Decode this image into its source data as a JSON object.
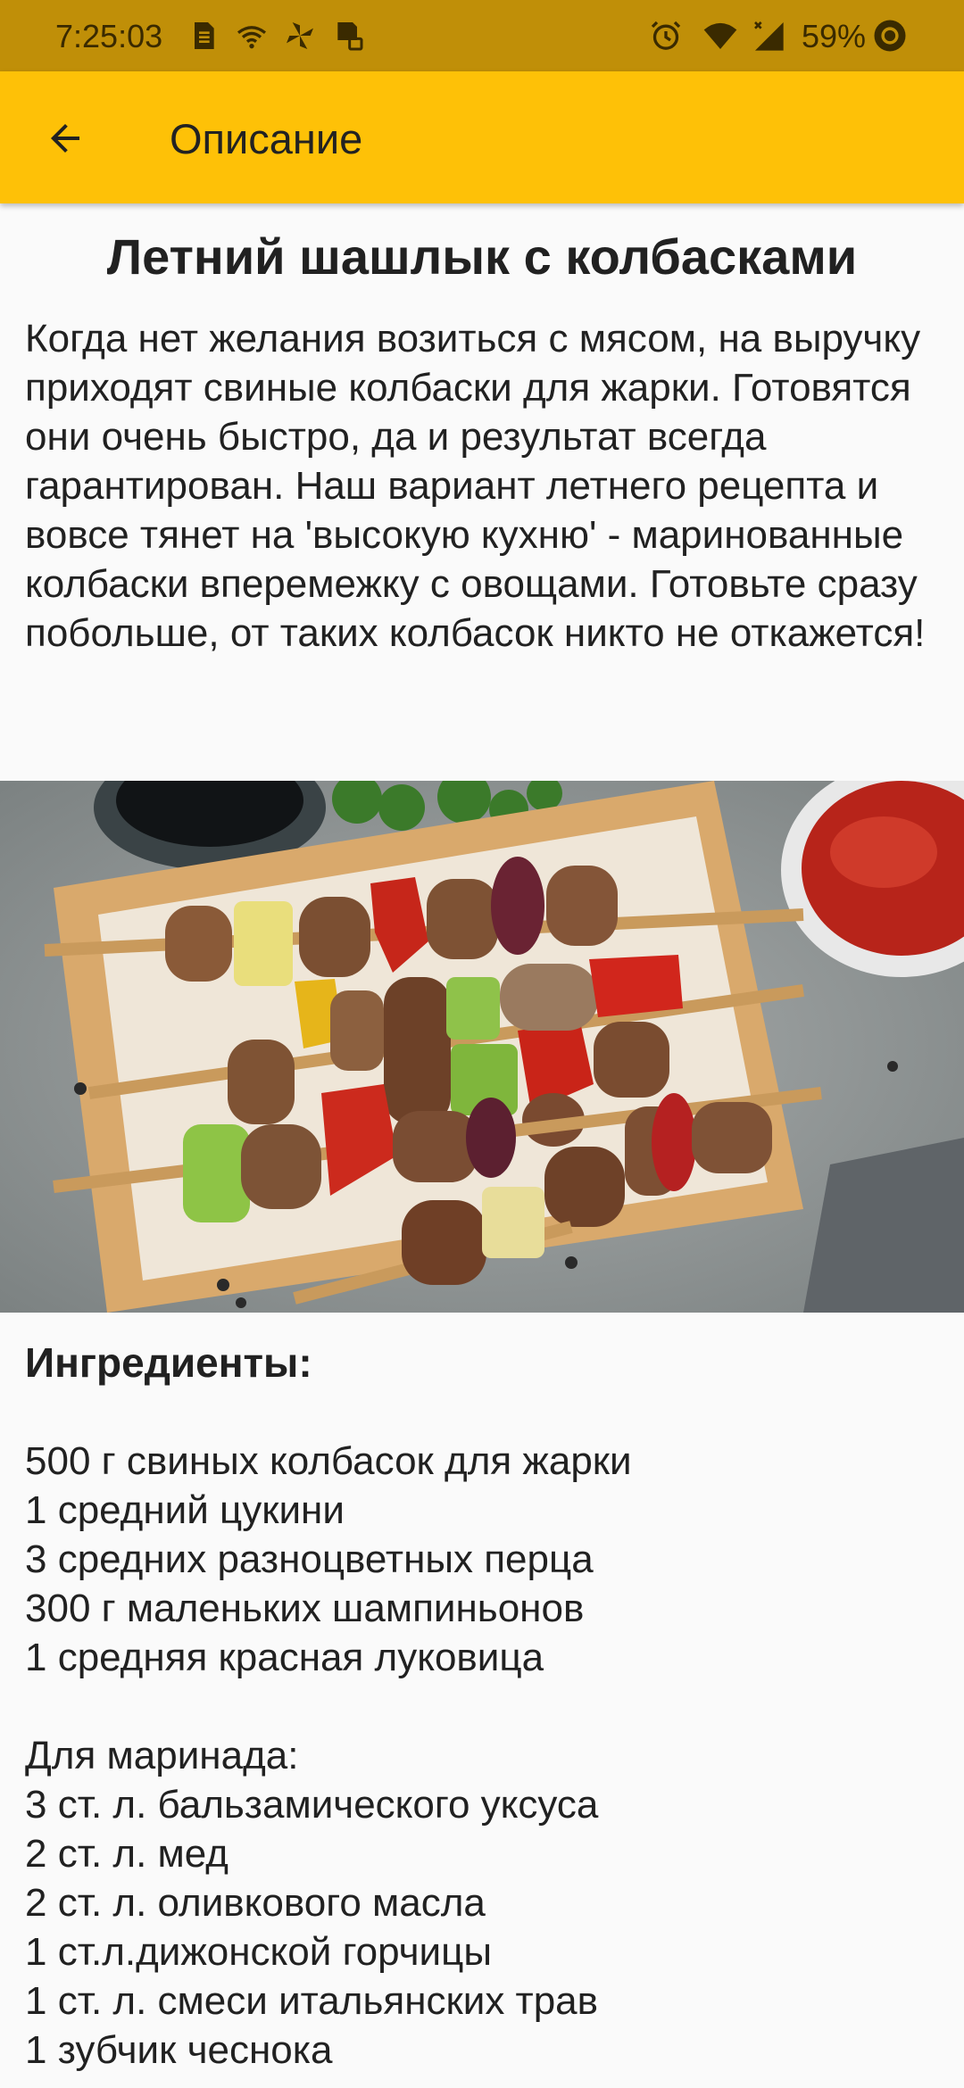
{
  "status_bar": {
    "time": "7:25:03",
    "battery_percent": "59%",
    "icons_left": [
      "sim-card-icon",
      "wifi-call-icon",
      "pinwheel-icon",
      "sd-card-icon"
    ],
    "icons_right": [
      "alarm-icon",
      "wifi-icon",
      "signal-icon",
      "battery-icon"
    ]
  },
  "app_bar": {
    "title": "Описание",
    "back_icon": "arrow-left-icon"
  },
  "recipe": {
    "title": "Летний шашлык с колбасками",
    "description": "Когда нет желания возиться с мясом, на выручку приходят свиные колбаски для жарки. Готовятся они очень быстро, да и результат всегда гарантирован. Наш вариант летнего рецепта и вовсе тянет на 'высокую кухню' - маринованные колбаски вперемежку с овощами. Готовьте сразу побольше, от таких колбасок никто не откажется!",
    "ingredients_heading": "Ингредиенты:",
    "ingredients": [
      "500 г свиных колбасок для жарки",
      "1 средний цукини",
      "3 средних разноцветных перца",
      "300 г маленьких шампиньонов",
      "1 средняя красная луковица"
    ],
    "marinade_heading": "Для маринада:",
    "marinade": [
      "3 ст. л. бальзамического уксуса",
      "2 ст. л. мед",
      "2 ст. л. оливкового масла",
      "1 ст.л.дижонской горчицы",
      "1 ст. л. смеси итальянских трав",
      "1 зубчик чеснока"
    ]
  }
}
